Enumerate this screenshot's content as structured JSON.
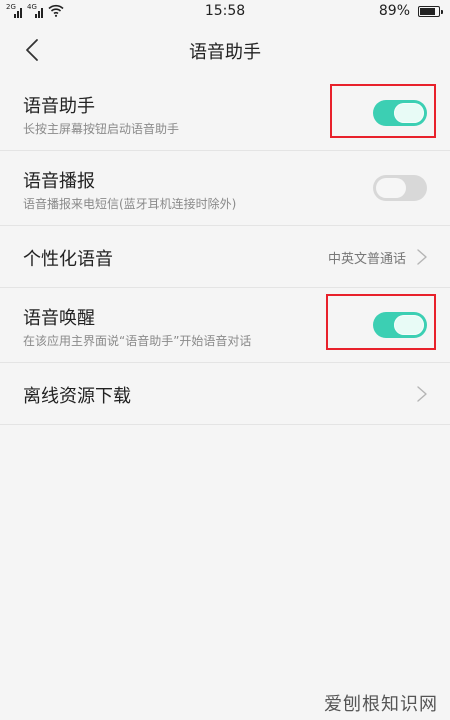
{
  "status_bar": {
    "sim1_label": "2G",
    "sim2_label": "4G",
    "time": "15:58",
    "battery": "89%",
    "battery_level": 0.89
  },
  "header": {
    "title": "语音助手",
    "back_icon": "chevron-left-icon"
  },
  "settings": [
    {
      "title": "语音助手",
      "subtitle": "长按主屏幕按钮启动语音助手",
      "type": "switch",
      "on": true,
      "highlighted": true
    },
    {
      "title": "语音播报",
      "subtitle": "语音播报来电短信(蓝牙耳机连接时除外)",
      "type": "switch",
      "on": false,
      "highlighted": false
    },
    {
      "title": "个性化语音",
      "value": "中英文普通话",
      "type": "link"
    },
    {
      "title": "语音唤醒",
      "subtitle": "在该应用主界面说“语音助手”开始语音对话",
      "type": "switch",
      "on": true,
      "highlighted": true
    },
    {
      "title": "离线资源下载",
      "type": "link"
    }
  ],
  "colors": {
    "switch_on": "#3ccfb3",
    "switch_off": "#d8d8d8",
    "highlight": "#e8212b",
    "background": "#f5f5f5"
  },
  "watermark": "爱刨根知识网"
}
